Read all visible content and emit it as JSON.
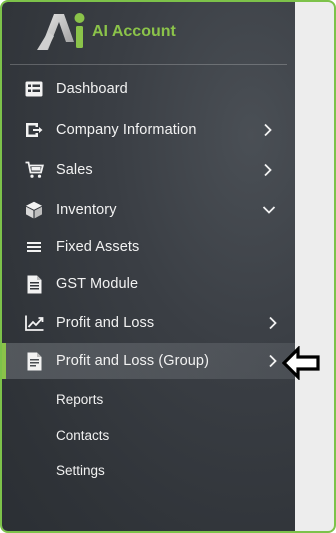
{
  "brand": {
    "name": "AI Account",
    "accent": "#8bc34a"
  },
  "menu": {
    "items": [
      {
        "label": "Dashboard",
        "icon": "dashboard-icon"
      },
      {
        "label": "Company Information",
        "icon": "company-icon"
      },
      {
        "label": "Sales",
        "icon": "cart-icon"
      },
      {
        "label": "Inventory",
        "icon": "box-icon"
      },
      {
        "label": "Fixed Assets",
        "icon": "list-icon"
      },
      {
        "label": "GST Module",
        "icon": "document-icon"
      },
      {
        "label": "Profit and Loss",
        "icon": "chart-icon"
      },
      {
        "label": "Profit and Loss (Group)",
        "icon": "document-icon",
        "active": true
      }
    ],
    "sub_items": [
      {
        "label": "Reports"
      },
      {
        "label": "Contacts"
      },
      {
        "label": "Settings"
      }
    ]
  },
  "annotation": {
    "icon": "left-arrow-icon"
  }
}
